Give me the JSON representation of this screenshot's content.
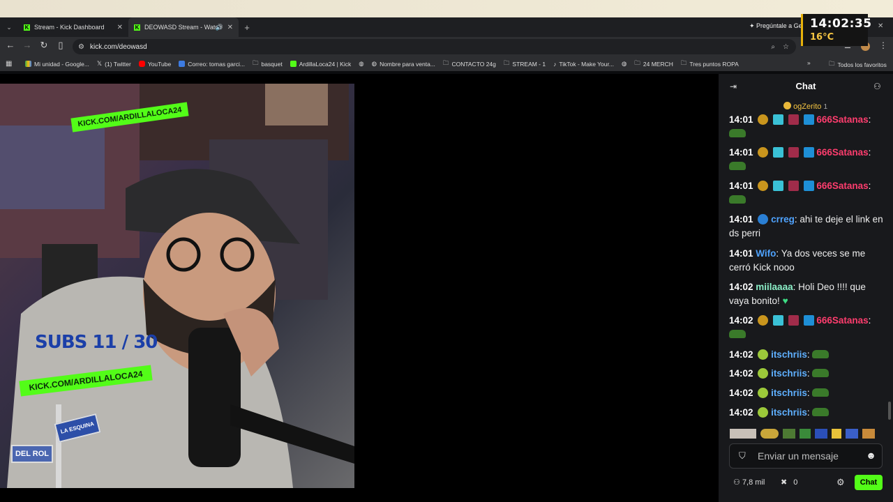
{
  "browser": {
    "tabs": [
      {
        "title": "Stream - Kick Dashboard"
      },
      {
        "title": "DEOWASD Stream - Watch"
      }
    ],
    "url": "kick.com/deowasd",
    "gemini": "Pregúntale a Gemi",
    "bookmarks": [
      "Mi unidad - Google...",
      "(1) Twitter",
      "YouTube",
      "Correo: tomas garci...",
      "basquet",
      "ArdillaLoca24 | Kick",
      "",
      "Nombre para venta...",
      "CONTACTO 24g",
      "STREAM - 1",
      "TikTok - Make Your...",
      "",
      "24 MERCH",
      "Tres puntos  ROPA"
    ],
    "all_bookmarks": "Todos los favoritos"
  },
  "overlay": {
    "time": "14:02:35",
    "temp": "16°C"
  },
  "video": {
    "kick_top": "KICK.COM/ARDILLALOCA24",
    "subs": "SUBS 11 / 30",
    "kick_bottom": "KICK.COM/ARDILLALOCA24",
    "sign1": "LA ESQUINA",
    "sign2": "DEL ROL"
  },
  "chat": {
    "title": "Chat",
    "pinned_user": "ogZerito",
    "pinned_count": "1",
    "messages": [
      {
        "time": "14:01",
        "user": "666Satanas",
        "text": ""
      },
      {
        "time": "14:01",
        "user": "666Satanas",
        "text": ""
      },
      {
        "time": "14:01",
        "user": "666Satanas",
        "text": ""
      },
      {
        "time": "14:01",
        "user": "crreg",
        "text": "ahi te deje el link en ds perri"
      },
      {
        "time": "14:01",
        "user": "Wifo",
        "text": "Ya dos veces se me cerró Kick nooo"
      },
      {
        "time": "14:02",
        "user": "miilaaaa",
        "text": "Holi Deo !!!! que vaya bonito!"
      },
      {
        "time": "14:02",
        "user": "666Satanas",
        "text": ""
      },
      {
        "time": "14:02",
        "user": "itschriis",
        "text": ""
      },
      {
        "time": "14:02",
        "user": "itschriis",
        "text": ""
      },
      {
        "time": "14:02",
        "user": "itschriis",
        "text": ""
      },
      {
        "time": "14:02",
        "user": "itschriis",
        "text": ""
      }
    ],
    "input_placeholder": "Enviar un mensaje",
    "viewers": "7,8 mil",
    "points": "0",
    "chat_button": "Chat"
  },
  "colors": {
    "kick_green": "#53fc18",
    "satanas": "#ff3d6e",
    "crreg": "#4fa3ff",
    "wifo": "#4fa3ff",
    "miilaaaa": "#8cf0c8",
    "itschriis": "#5fb0ff"
  }
}
